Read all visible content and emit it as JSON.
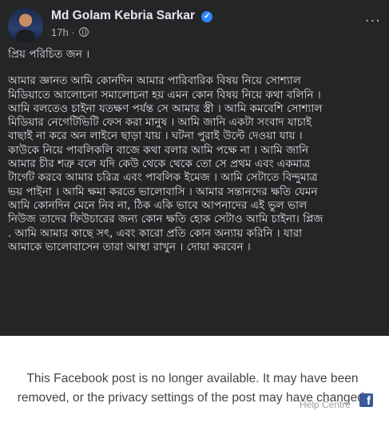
{
  "post": {
    "author": "Md Golam Kebria Sarkar",
    "time": "17h",
    "separator": "·",
    "more_label": "···",
    "greeting": "প্রিয় পরিচিত জন ।",
    "lines": [
      "আমার জ্ঞানত আমি কোনদিন আমার পারিবারিক বিষয় নিয়ে সোশ্যাল",
      "মিডিয়াতে আলোচনা সমালোচনা হয় এমন কোন বিষয় নিয়ে কথা বলিনি ।",
      "আমি বলতেও চাইনা যতক্ষণ পর্যন্ত সে আমার স্ত্রী । আমি কমবেশি সোশ্যাল",
      "মিডিয়ার নেগেটিভিটি ফেস করা মানুষ । আমি জানি একটা সংবাদ যাচাই",
      "বাছাই না করে অন লাইনে ছাড়া যায় । ঘটনা পুরাই উল্টে দেওয়া যায় ।",
      "কাউকে নিয়ে পাবলিকলি বাজে কথা বলার আমি পক্ষে না । আমি জানি",
      "আমার চীর শত্রু বলে যদি কেউ থেকে থেকে তো সে প্রথম এবং একমাত্র",
      "টার্গেট করবে আমার চরিত্র এবং পাবলিক ইমেজ । আমি সেটাতে বিন্দুমাত্র",
      "ভয় পাইনা । আমি ক্ষমা করতে ভালোবাসি । আমার সন্তানদের ক্ষতি যেমন",
      "আমি কোনদিন মেনে নিব না, ঠিক একি ভাবে আপনাদের এই ভুল ভাল",
      "নিউজ তাদের ফিউচারের জন্য কোন ক্ষতি হোক সেটাও আমি চাইনা। প্লিজ",
      ". আমি আমার কাছে সৎ, এবং কারো প্রতি কোন অন্যায় করিনি । যারা",
      "আমাকে ভালোবাসেন তারা আস্থা রাখুন । দোয়া করবেন ।"
    ]
  },
  "notice": {
    "line1": "This Facebook post is no longer available. It may have been",
    "line2": "removed, or the privacy settings of the post may have changed.",
    "help_link": "Help Centre"
  },
  "colors": {
    "post_bg": "#242526",
    "text": "#e4e6eb",
    "secondary_text": "#b0b3b8",
    "verified": "#2d88ff",
    "facebook_blue": "#3b5998"
  },
  "icons": [
    "verified-badge-icon",
    "globe-icon",
    "more-options-icon",
    "facebook-logo-icon"
  ]
}
